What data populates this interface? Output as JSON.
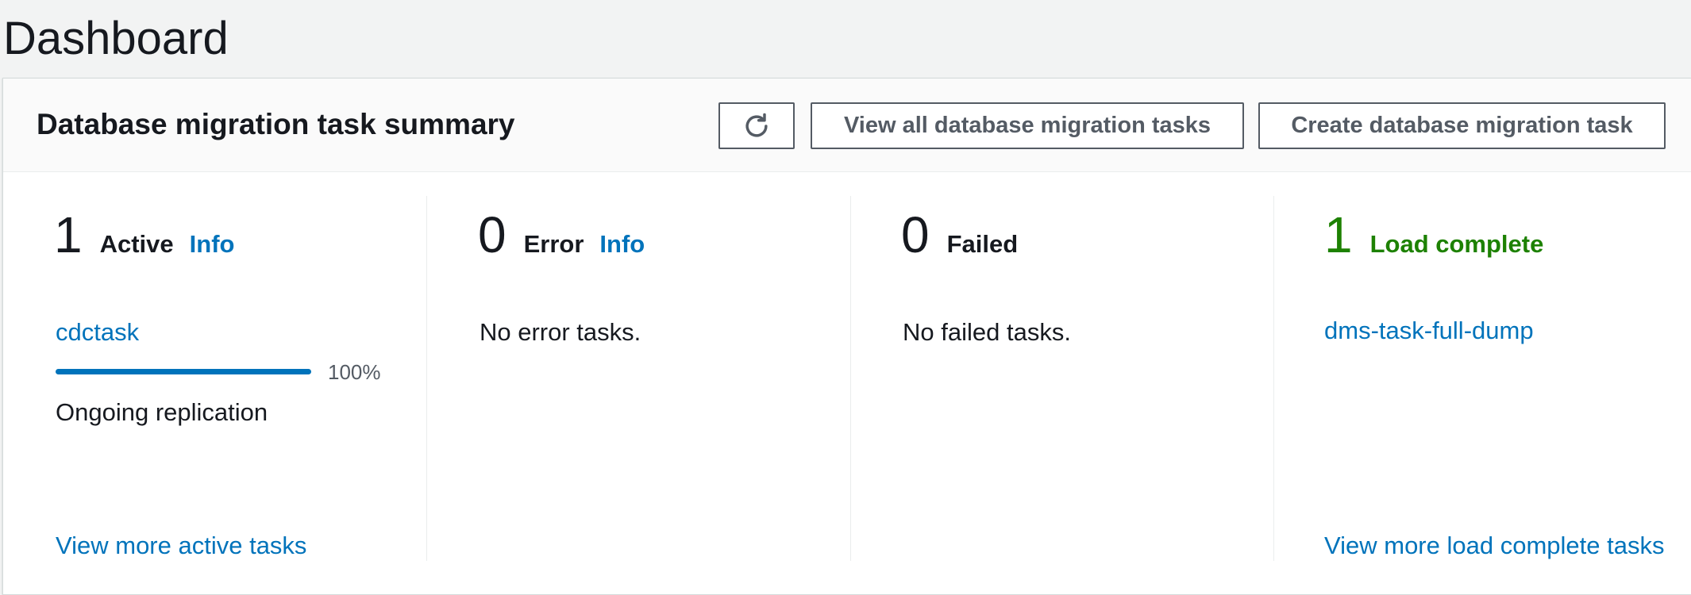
{
  "page": {
    "title": "Dashboard"
  },
  "summary": {
    "title": "Database migration task summary",
    "refresh_icon": "refresh-icon",
    "view_all_label": "View all database migration tasks",
    "create_label": "Create database migration task"
  },
  "columns": {
    "active": {
      "count": "1",
      "label": "Active",
      "info": "Info",
      "task_name": "cdctask",
      "progress_percent": 100,
      "progress_label": "100%",
      "status": "Ongoing replication",
      "more_link": "View more active tasks"
    },
    "error": {
      "count": "0",
      "label": "Error",
      "info": "Info",
      "empty_text": "No error tasks."
    },
    "failed": {
      "count": "0",
      "label": "Failed",
      "empty_text": "No failed tasks."
    },
    "load_complete": {
      "count": "1",
      "label": "Load complete",
      "task_name": "dms-task-full-dump",
      "more_link": "View more load complete tasks"
    }
  },
  "colors": {
    "link": "#0073bb",
    "success": "#1d8102",
    "text": "#16191f",
    "button_border": "#545b64"
  }
}
